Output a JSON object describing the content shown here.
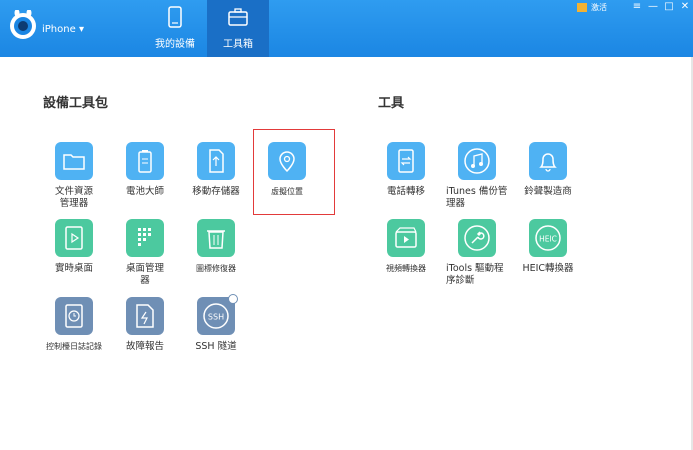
{
  "header": {
    "device_name": "iPhone",
    "tabs": [
      {
        "label": "我的設備"
      },
      {
        "label": "工具箱"
      }
    ],
    "activation_label": "激活"
  },
  "colors": {
    "topbar": "#2f9cf0",
    "active_tab": "#1a6fc6",
    "blue_tile": "#4fb2f3",
    "green_tile": "#4cc99f",
    "navy_tile": "#6f8fb5",
    "highlight": "#e23a3a"
  },
  "sections": {
    "device_tools": {
      "title": "設備工具包",
      "items": [
        {
          "label": "文件資源管理器",
          "icon": "folder-icon"
        },
        {
          "label": "電池大師",
          "icon": "battery-icon"
        },
        {
          "label": "移動存儲器",
          "icon": "usb-drive-icon"
        },
        {
          "label": "虛擬位置",
          "icon": "location-pin-icon"
        },
        {
          "label": "實時桌面",
          "icon": "play-icon"
        },
        {
          "label": "桌面管理器",
          "icon": "grid-icon"
        },
        {
          "label": "圖標修復器",
          "icon": "trash-icon"
        },
        {
          "label": "控制檯日誌記錄",
          "icon": "clock-log-icon"
        },
        {
          "label": "故障報告",
          "icon": "crash-report-icon"
        },
        {
          "label": "SSH 隧道",
          "icon": "ssh-icon"
        }
      ]
    },
    "tools": {
      "title": "工具",
      "items": [
        {
          "label": "電話轉移",
          "icon": "phone-transfer-icon"
        },
        {
          "label": "iTunes 備份管理器",
          "icon": "music-icon"
        },
        {
          "label": "鈴聲製造商",
          "icon": "bell-icon"
        },
        {
          "label": "視頻轉換器",
          "icon": "video-convert-icon"
        },
        {
          "label": "iTools 驅動程序診斷",
          "icon": "wrench-icon"
        },
        {
          "label": "HEIC轉換器",
          "icon": "heic-icon"
        }
      ]
    }
  }
}
